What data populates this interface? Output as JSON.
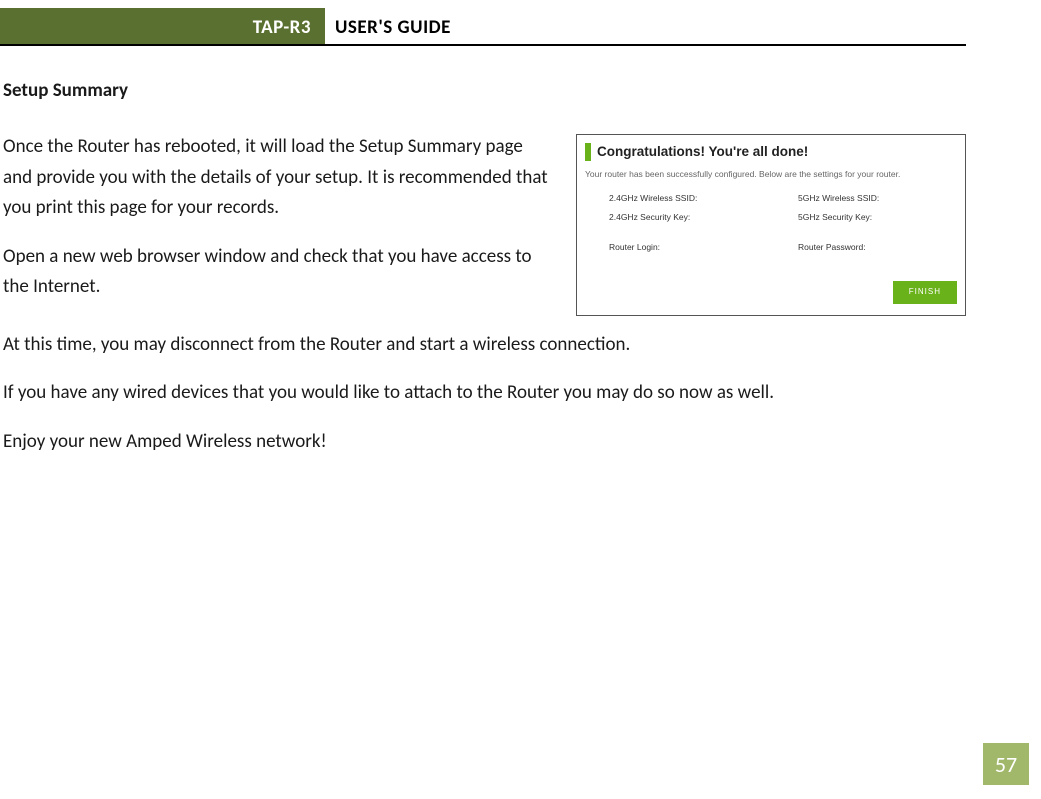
{
  "header": {
    "model": "TAP-R3",
    "title": "USER'S GUIDE"
  },
  "section_heading": "Setup Summary",
  "paragraphs": {
    "p1": "Once the Router has rebooted, it will load the Setup Summary page and provide you with the details of your setup. It is recommended that you print this page for your records.",
    "p2": "Open a new web browser window and check that you have access to the Internet.",
    "p3": "At this time, you may disconnect from the Router and start a wireless connection.",
    "p4": "If you have any wired devices that you would like to attach to the Router you may do so now as well.",
    "p5": "Enjoy your new Amped Wireless network!"
  },
  "screenshot": {
    "title": "Congratulations! You're all done!",
    "subtitle": "Your router has been successfully configured. Below are the settings for your router.",
    "labels": {
      "ssid24": "2.4GHz Wireless SSID:",
      "ssid5": "5GHz Wireless SSID:",
      "key24": "2.4GHz Security Key:",
      "key5": "5GHz Security Key:",
      "login": "Router Login:",
      "password": "Router Password:"
    },
    "finish": "FINISH"
  },
  "page_number": "57"
}
